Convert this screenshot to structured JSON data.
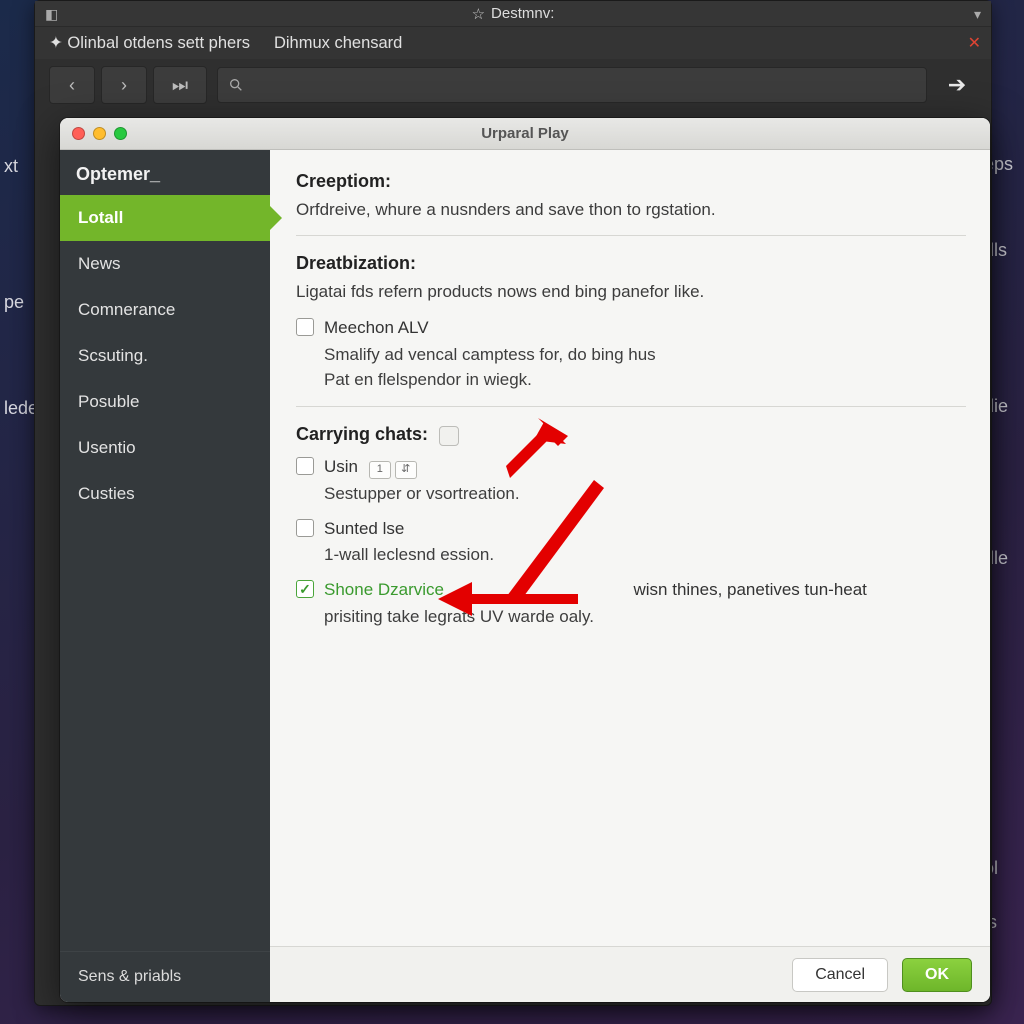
{
  "desktop": {
    "left_labels": [
      "xt",
      "pe",
      "lede"
    ],
    "right_labels": [
      "eps",
      "dls",
      "die",
      "dle",
      "ol",
      "ls"
    ]
  },
  "main_window": {
    "title": "Destmnv:",
    "tabs": {
      "tab1": "Olinbal otdens sett phers",
      "tab2": "Dihmux chensard"
    },
    "search_placeholder": ""
  },
  "prefs": {
    "title": "Urparal Play",
    "sidebar": {
      "header": "Optemer_",
      "items": [
        "Lotall",
        "News",
        "Comnerance",
        "Scsuting.",
        "Posuble",
        "Usentio",
        "Custies"
      ],
      "active_index": 0,
      "footer": "Sens & priabls"
    },
    "content": {
      "section1": {
        "title": "Creeptiom:",
        "text": "Orfdreive, whure a nusnders and save thon to rgstation."
      },
      "section2": {
        "title": "Dreatbization:",
        "text": "Ligatai fds refern products nows end bing panefor like.",
        "check1": {
          "label": "Meechon ALV",
          "sub1": "Smalify ad vencal camptess for, do bing hus",
          "sub2": "Pat en flelspendor in wiegk."
        }
      },
      "section3": {
        "title": "Carrying chats:",
        "check1": {
          "label": "Usin",
          "field_value": "1",
          "sub": "Sestupper or vsortreation."
        },
        "check2": {
          "label": "Sunted lse",
          "sub": "1-wall leclesnd ession."
        },
        "check3": {
          "label": "Shone Dzarvice",
          "tail": "wisn thines, panetives tun-heat",
          "sub": "prisiting take legrats UV warde oaly."
        }
      }
    },
    "buttons": {
      "cancel": "Cancel",
      "ok": "OK"
    }
  }
}
